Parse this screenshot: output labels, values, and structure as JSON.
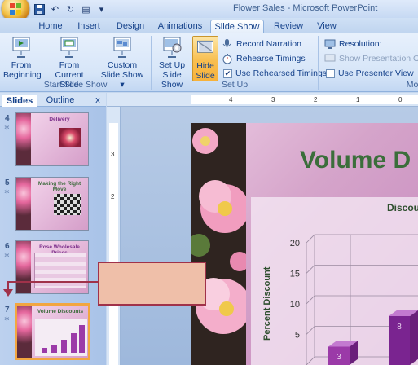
{
  "window": {
    "title": "Flower Sales - Microsoft PowerPoint"
  },
  "qat": {
    "icons": [
      "save-icon",
      "undo-icon",
      "redo-icon",
      "layout-icon",
      "customize-icon"
    ]
  },
  "tabs": [
    "Home",
    "Insert",
    "Design",
    "Animations",
    "Slide Show",
    "Review",
    "View"
  ],
  "active_tab": "Slide Show",
  "ribbon": {
    "start": {
      "from_beginning": "From Beginning",
      "from_beginning_l1": "From",
      "from_beginning_l2": "Beginning",
      "from_current_l1": "From",
      "from_current_l2": "Current Slide",
      "custom_l1": "Custom",
      "custom_l2": "Slide Show",
      "group": "Start Slide Show"
    },
    "setup": {
      "setup_l1": "Set Up",
      "setup_l2": "Slide Show",
      "hide_l1": "Hide",
      "hide_l2": "Slide",
      "record": "Record Narration",
      "rehearse": "Rehearse Timings",
      "use_rehearsed": "Use Rehearsed Timings",
      "use_rehearsed_checked": true,
      "group": "Set Up"
    },
    "monitors": {
      "resolution": "Resolution:",
      "show_on": "Show Presentation On:",
      "presenter": "Use Presenter View",
      "group": "Mo"
    }
  },
  "pane": {
    "tabs": [
      "Slides",
      "Outline"
    ],
    "close": "x",
    "slides": [
      {
        "num": "4",
        "title": "Delivery"
      },
      {
        "num": "5",
        "title": "Making the Right Move"
      },
      {
        "num": "6",
        "title": "Rose Wholesale Prices"
      },
      {
        "num": "7",
        "title": "Volume Discounts"
      }
    ],
    "selected_slide": "7"
  },
  "ruler": {
    "h_ticks": [
      "4",
      "3",
      "2",
      "1",
      "0"
    ],
    "v_ticks": [
      "3",
      "2"
    ]
  },
  "slide": {
    "title": "Volume D",
    "chart_title": "Discou",
    "ylabel": "Percent Discount"
  },
  "chart_data": {
    "type": "bar",
    "title": "Discou",
    "ylabel": "Percent Discount",
    "yticks": [
      "20",
      "15",
      "10",
      "5"
    ],
    "ylim": [
      0,
      20
    ],
    "values": [
      3,
      8
    ],
    "data_labels": [
      "3",
      "8"
    ],
    "colors": [
      "#9b3aa8",
      "#7a2490"
    ]
  },
  "colors": {
    "accent": "#f7b23b",
    "callout_fill": "#efbfa9",
    "callout_border": "#a0324a"
  }
}
